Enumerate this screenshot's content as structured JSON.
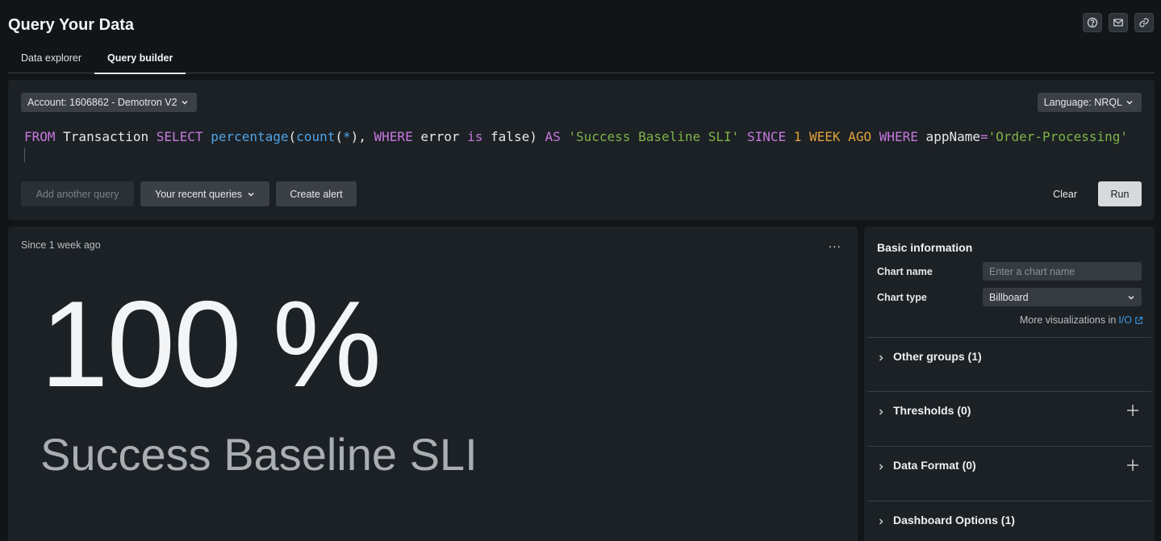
{
  "header": {
    "title": "Query Your Data",
    "icons": [
      "help-icon",
      "mail-icon",
      "link-icon"
    ]
  },
  "tabs": [
    {
      "label": "Data explorer",
      "active": false
    },
    {
      "label": "Query builder",
      "active": true
    }
  ],
  "query": {
    "account_label": "Account: 1606862 - Demotron V2",
    "language_label": "Language: NRQL",
    "tokens": {
      "t1": "FROM",
      "t2": " Transaction ",
      "t3": "SELECT",
      "t4": " ",
      "t5": "percentage",
      "t6": "(",
      "t7": "count",
      "t8": "(",
      "t9": "*",
      "t10": "), ",
      "t11": "WHERE",
      "t12": " error ",
      "t13": "is",
      "t14": " false) ",
      "t15": "AS",
      "t16": " ",
      "t17": "'Success Baseline SLI'",
      "t18": " ",
      "t19": "SINCE",
      "t20": " ",
      "t21": "1",
      "t22": " ",
      "t23": "WEEK",
      "t24": " ",
      "t25": "AGO",
      "t26": " ",
      "t27": "WHERE",
      "t28": " appName",
      "t29": "=",
      "t30": "'Order-Processing'"
    },
    "buttons": {
      "add_query": "Add another query",
      "recent_queries": "Your recent queries",
      "create_alert": "Create alert",
      "clear": "Clear",
      "run": "Run"
    }
  },
  "chart": {
    "since": "Since 1 week ago",
    "more": "...",
    "value": "100 %",
    "label": "Success Baseline SLI"
  },
  "settings": {
    "section_title": "Basic information",
    "chart_name_label": "Chart name",
    "chart_name_placeholder": "Enter a chart name",
    "chart_name_value": "",
    "chart_type_label": "Chart type",
    "chart_type_value": "Billboard",
    "more_viz_text": "More visualizations in",
    "more_viz_link": "I/O",
    "sections": [
      {
        "title": "Other groups (1)",
        "has_add": false
      },
      {
        "title": "Thresholds (0)",
        "has_add": true
      },
      {
        "title": "Data Format (0)",
        "has_add": true
      },
      {
        "title": "Dashboard Options (1)",
        "has_add": false
      }
    ]
  },
  "colors": {
    "background": "#111518",
    "panel": "#1c2125",
    "keyword": "#c678dd",
    "function": "#4fa3e6",
    "string": "#7fb347",
    "number": "#e0a23c",
    "link": "#3d9be9"
  }
}
